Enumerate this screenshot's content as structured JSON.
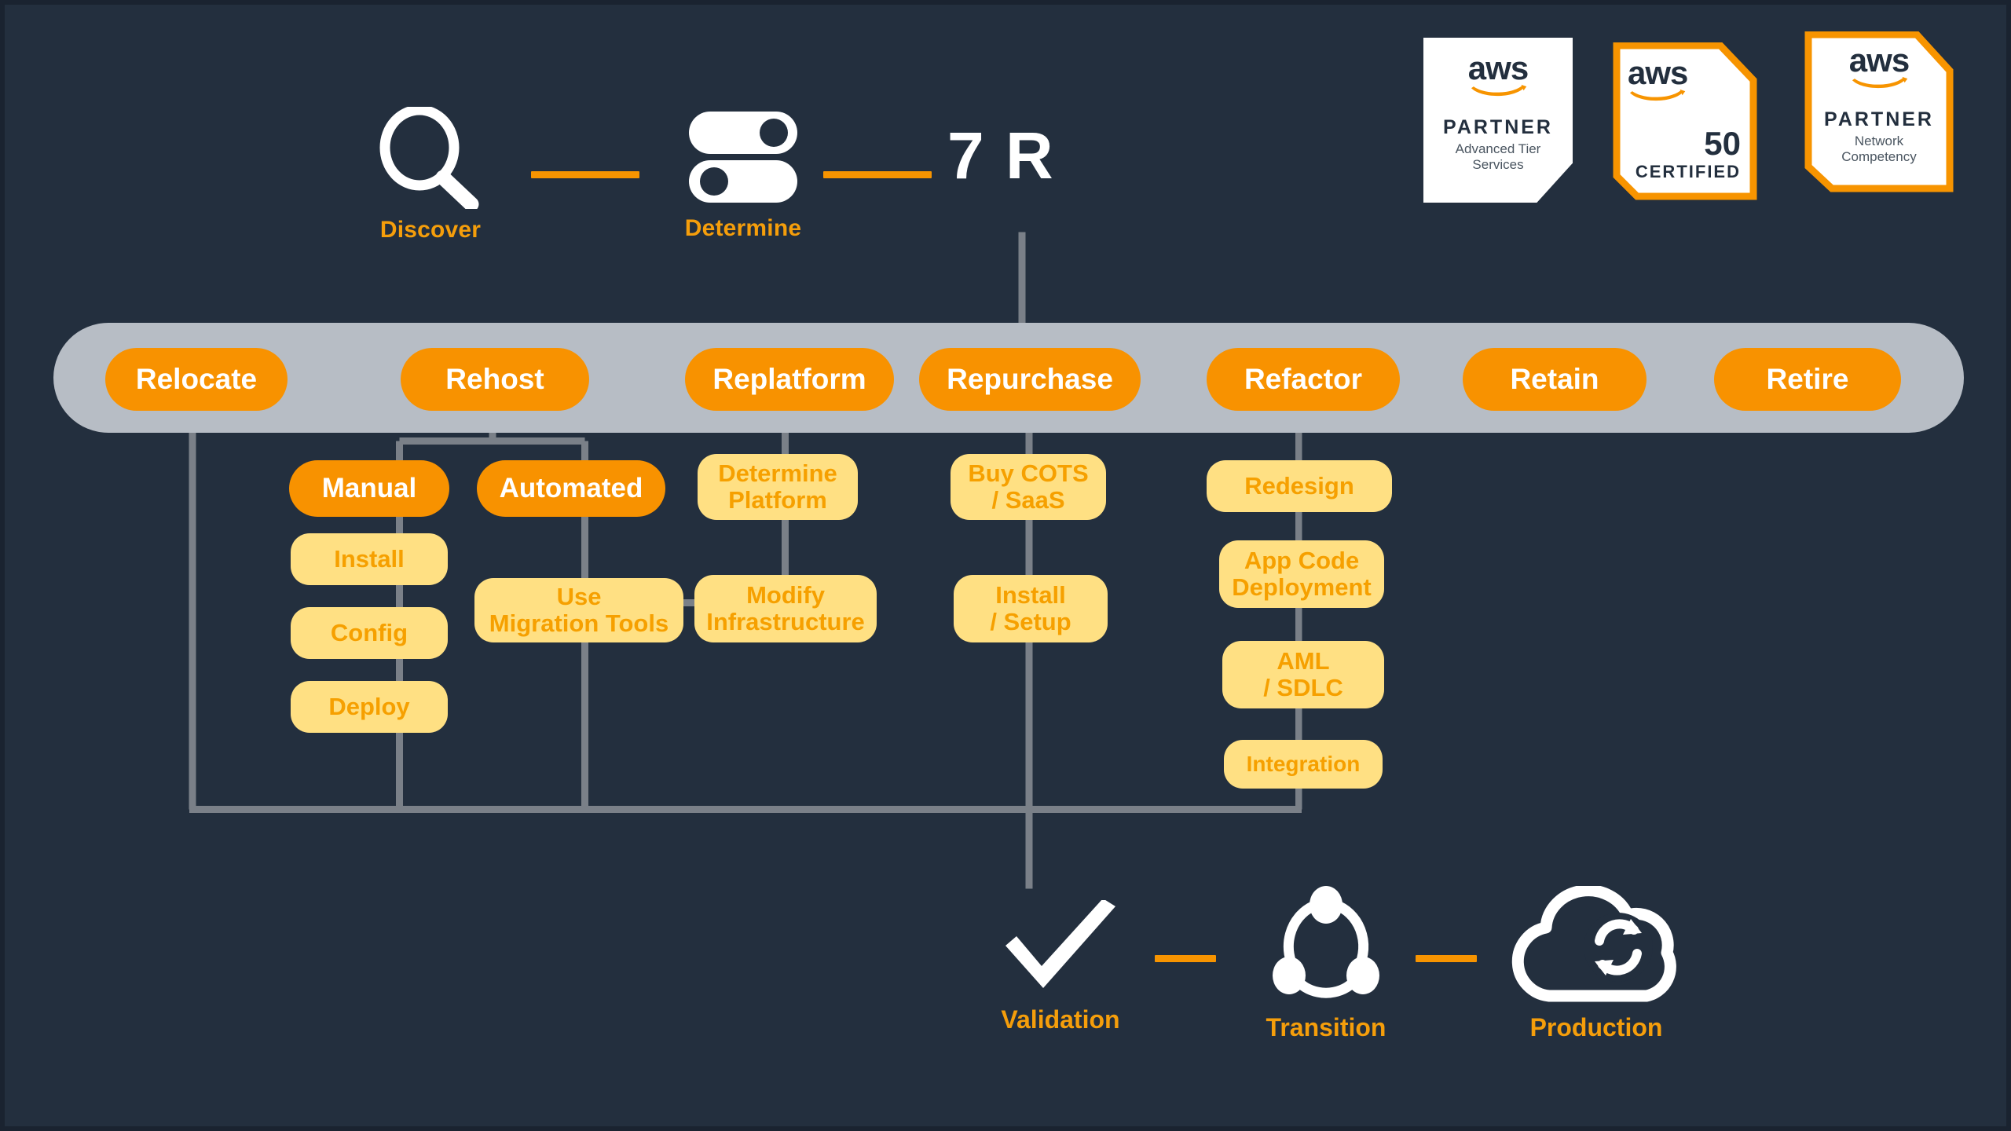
{
  "theme": {
    "background": "#232F3E",
    "rail": "#B7BDC5",
    "orange": "#F89200",
    "orange_text": "#F59E0B",
    "soft_yellow": "#FFE083",
    "soft_yellow_text": "#F6A000",
    "connector": "#7A8088",
    "white": "#FFFFFF"
  },
  "badges": [
    {
      "logo": "aws",
      "title": "PARTNER",
      "subtitle": "Advanced Tier\nServices",
      "sub_line1": "Advanced Tier",
      "sub_line2": "Services",
      "accent": "#FFFFFF",
      "style": "white"
    },
    {
      "logo": "aws",
      "number": "50",
      "title": "CERTIFIED",
      "accent": "#F79400",
      "style": "orange"
    },
    {
      "logo": "aws",
      "title": "PARTNER",
      "sub_line1": "Network",
      "sub_line2": "Competency",
      "accent": "#F79400",
      "style": "orange"
    }
  ],
  "top_flow": {
    "steps": [
      {
        "id": "discover",
        "icon": "magnifier-icon",
        "label": "Discover"
      },
      {
        "id": "determine",
        "icon": "toggles-icon",
        "label": "Determine"
      },
      {
        "id": "sevenr",
        "icon": "text-7r",
        "label": "7 R",
        "text": "7 R"
      }
    ],
    "connector_color": "#F79400"
  },
  "rail": {
    "items": [
      {
        "id": "relocate",
        "label": "Relocate"
      },
      {
        "id": "rehost",
        "label": "Rehost"
      },
      {
        "id": "replatform",
        "label": "Replatform"
      },
      {
        "id": "repurchase",
        "label": "Repurchase"
      },
      {
        "id": "refactor",
        "label": "Refactor"
      },
      {
        "id": "retain",
        "label": "Retain"
      },
      {
        "id": "retire",
        "label": "Retire"
      }
    ]
  },
  "branches": {
    "rehost": {
      "manual": {
        "header": "Manual",
        "steps": [
          "Install",
          "Config",
          "Deploy"
        ]
      },
      "automated": {
        "header": "Automated",
        "steps": [
          "Use\nMigration Tools"
        ],
        "step_line1": "Use",
        "step_line2": "Migration Tools"
      }
    },
    "replatform": {
      "steps": [
        {
          "line1": "Determine",
          "line2": "Platform"
        },
        {
          "line1": "Modify",
          "line2": "Infrastructure"
        }
      ]
    },
    "repurchase": {
      "steps": [
        {
          "line1": "Buy COTS",
          "line2": "/ SaaS"
        },
        {
          "line1": "Install",
          "line2": "/ Setup"
        }
      ]
    },
    "refactor": {
      "steps": [
        {
          "line1": "Redesign",
          "line2": ""
        },
        {
          "line1": "App Code",
          "line2": "Deployment"
        },
        {
          "line1": "AML",
          "line2": "/ SDLC"
        },
        {
          "line1": "Integration",
          "line2": ""
        }
      ]
    }
  },
  "bottom_flow": {
    "steps": [
      {
        "id": "validation",
        "icon": "checkmark-icon",
        "label": "Validation"
      },
      {
        "id": "transition",
        "icon": "transition-icon",
        "label": "Transition"
      },
      {
        "id": "production",
        "icon": "cloud-sync-icon",
        "label": "Production"
      }
    ],
    "connector_color": "#F79400"
  }
}
